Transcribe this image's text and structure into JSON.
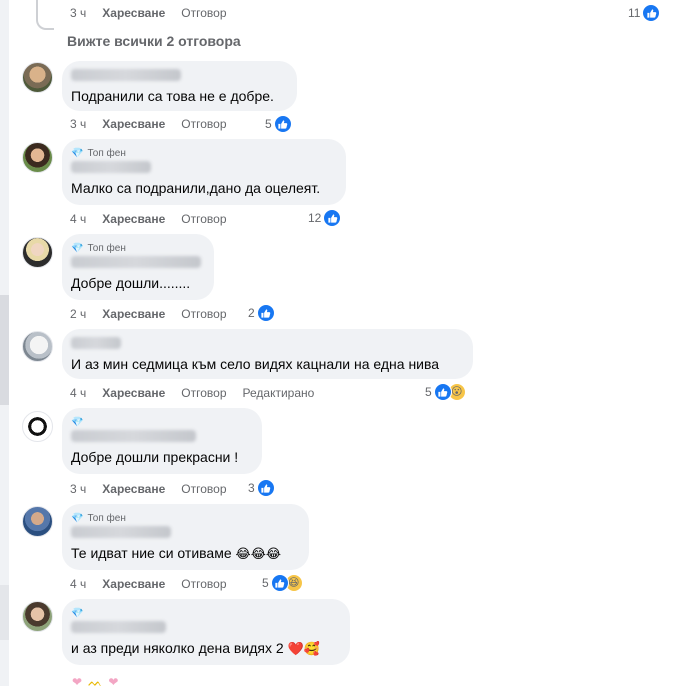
{
  "top_row": {
    "time": "3 ч",
    "like_label": "Харесване",
    "reply_label": "Отговор",
    "reaction_count": "11"
  },
  "see_all_replies": "Вижте всички 2 отговора",
  "comments": [
    {
      "top_fan": "",
      "text": "Подранили са това не е добре.",
      "time": "3 ч",
      "like_label": "Харесване",
      "reply_label": "Отговор",
      "edited_label": "",
      "reaction_count": "5",
      "reactions": [
        "like"
      ]
    },
    {
      "top_fan": "Топ фен",
      "text": "Малко са подранили,дано да оцелеят.",
      "time": "4 ч",
      "like_label": "Харесване",
      "reply_label": "Отговор",
      "edited_label": "",
      "reaction_count": "12",
      "reactions": [
        "like"
      ]
    },
    {
      "top_fan": "Топ фен",
      "text": "Добре дошли........",
      "time": "2 ч",
      "like_label": "Харесване",
      "reply_label": "Отговор",
      "edited_label": "",
      "reaction_count": "2",
      "reactions": [
        "like"
      ]
    },
    {
      "top_fan": "",
      "text": "И аз мин седмица към село видях кацнали на една нива",
      "time": "4 ч",
      "like_label": "Харесване",
      "reply_label": "Отговор",
      "edited_label": "Редактирано",
      "reaction_count": "5",
      "reactions": [
        "like",
        "wow"
      ]
    },
    {
      "top_fan": "",
      "text": "Добре дошли прекрасни !",
      "time": "3 ч",
      "like_label": "Харесване",
      "reply_label": "Отговор",
      "edited_label": "",
      "reaction_count": "3",
      "reactions": [
        "like"
      ]
    },
    {
      "top_fan": "Топ фен",
      "text": "Те идват ние си отиваме",
      "text_emoji": "😂😂😂",
      "time": "4 ч",
      "like_label": "Харесване",
      "reply_label": "Отговор",
      "edited_label": "",
      "reaction_count": "5",
      "reactions": [
        "like",
        "haha"
      ]
    },
    {
      "top_fan": "",
      "text": "и аз преди няколко дена видях 2",
      "text_emoji": "❤️🥰",
      "time": "",
      "like_label": "",
      "reply_label": "",
      "edited_label": "",
      "reaction_count": "",
      "reactions": []
    }
  ],
  "colors": {
    "like_blue": "#1877f2",
    "bubble_bg": "#f0f2f5",
    "meta_gray": "#65676b"
  }
}
